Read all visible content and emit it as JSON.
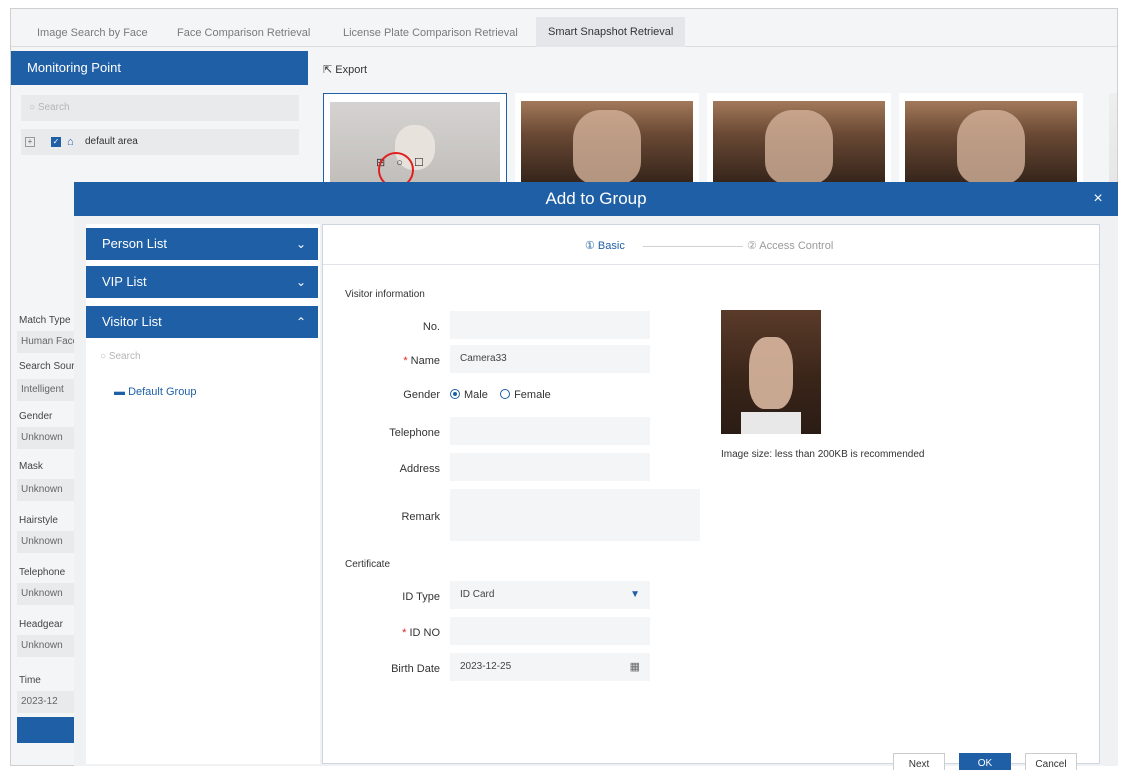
{
  "tabs": [
    {
      "label": "Image Search by Face"
    },
    {
      "label": "Face Comparison Retrieval"
    },
    {
      "label": "License Plate Comparison Retrieval"
    },
    {
      "label": "Smart Snapshot Retrieval"
    }
  ],
  "left_panel": {
    "header": "Monitoring Point",
    "search_placeholder": "Search",
    "tree_item": "default area",
    "filters": [
      {
        "label": "Match Type",
        "value": "Human Face"
      },
      {
        "label": "Search Source",
        "value": "Intelligent"
      },
      {
        "label": "Gender",
        "value": "Unknown"
      },
      {
        "label": "Mask",
        "value": "Unknown"
      },
      {
        "label": "Hairstyle",
        "value": "Unknown"
      },
      {
        "label": "Telephone",
        "value": "Unknown"
      },
      {
        "label": "Headgear",
        "value": "Unknown"
      },
      {
        "label": "Time",
        "value": "2023-12"
      }
    ]
  },
  "toolbar": {
    "export_label": "Export"
  },
  "thumb_icons": "⊞ ○ ☐",
  "modal": {
    "title": "Add to Group",
    "close": "×",
    "lists": [
      {
        "label": "Person List",
        "chevron": "⌄"
      },
      {
        "label": "VIP List",
        "chevron": "⌄"
      },
      {
        "label": "Visitor List",
        "chevron": "⌃"
      }
    ],
    "list_search_placeholder": "Search",
    "group_item": "Default Group",
    "steps": {
      "basic": "① Basic",
      "access": "② Access Control"
    },
    "visitor_section": "Visitor information",
    "certificate_section": "Certificate",
    "fields": {
      "no_label": "No.",
      "no_value": "",
      "name_label": "Name",
      "name_value": "Camera33",
      "gender_label": "Gender",
      "gender_male": "Male",
      "gender_female": "Female",
      "telephone_label": "Telephone",
      "address_label": "Address",
      "remark_label": "Remark",
      "id_type_label": "ID Type",
      "id_type_value": "ID Card",
      "id_no_label": "ID NO",
      "birth_label": "Birth Date",
      "birth_value": "2023-12-25"
    },
    "image_note": "Image size: less than 200KB is recommended",
    "buttons": {
      "next": "Next",
      "ok": "OK",
      "cancel": "Cancel"
    }
  },
  "colors": {
    "accent": "#1f5fa6",
    "required": "#e02020"
  }
}
